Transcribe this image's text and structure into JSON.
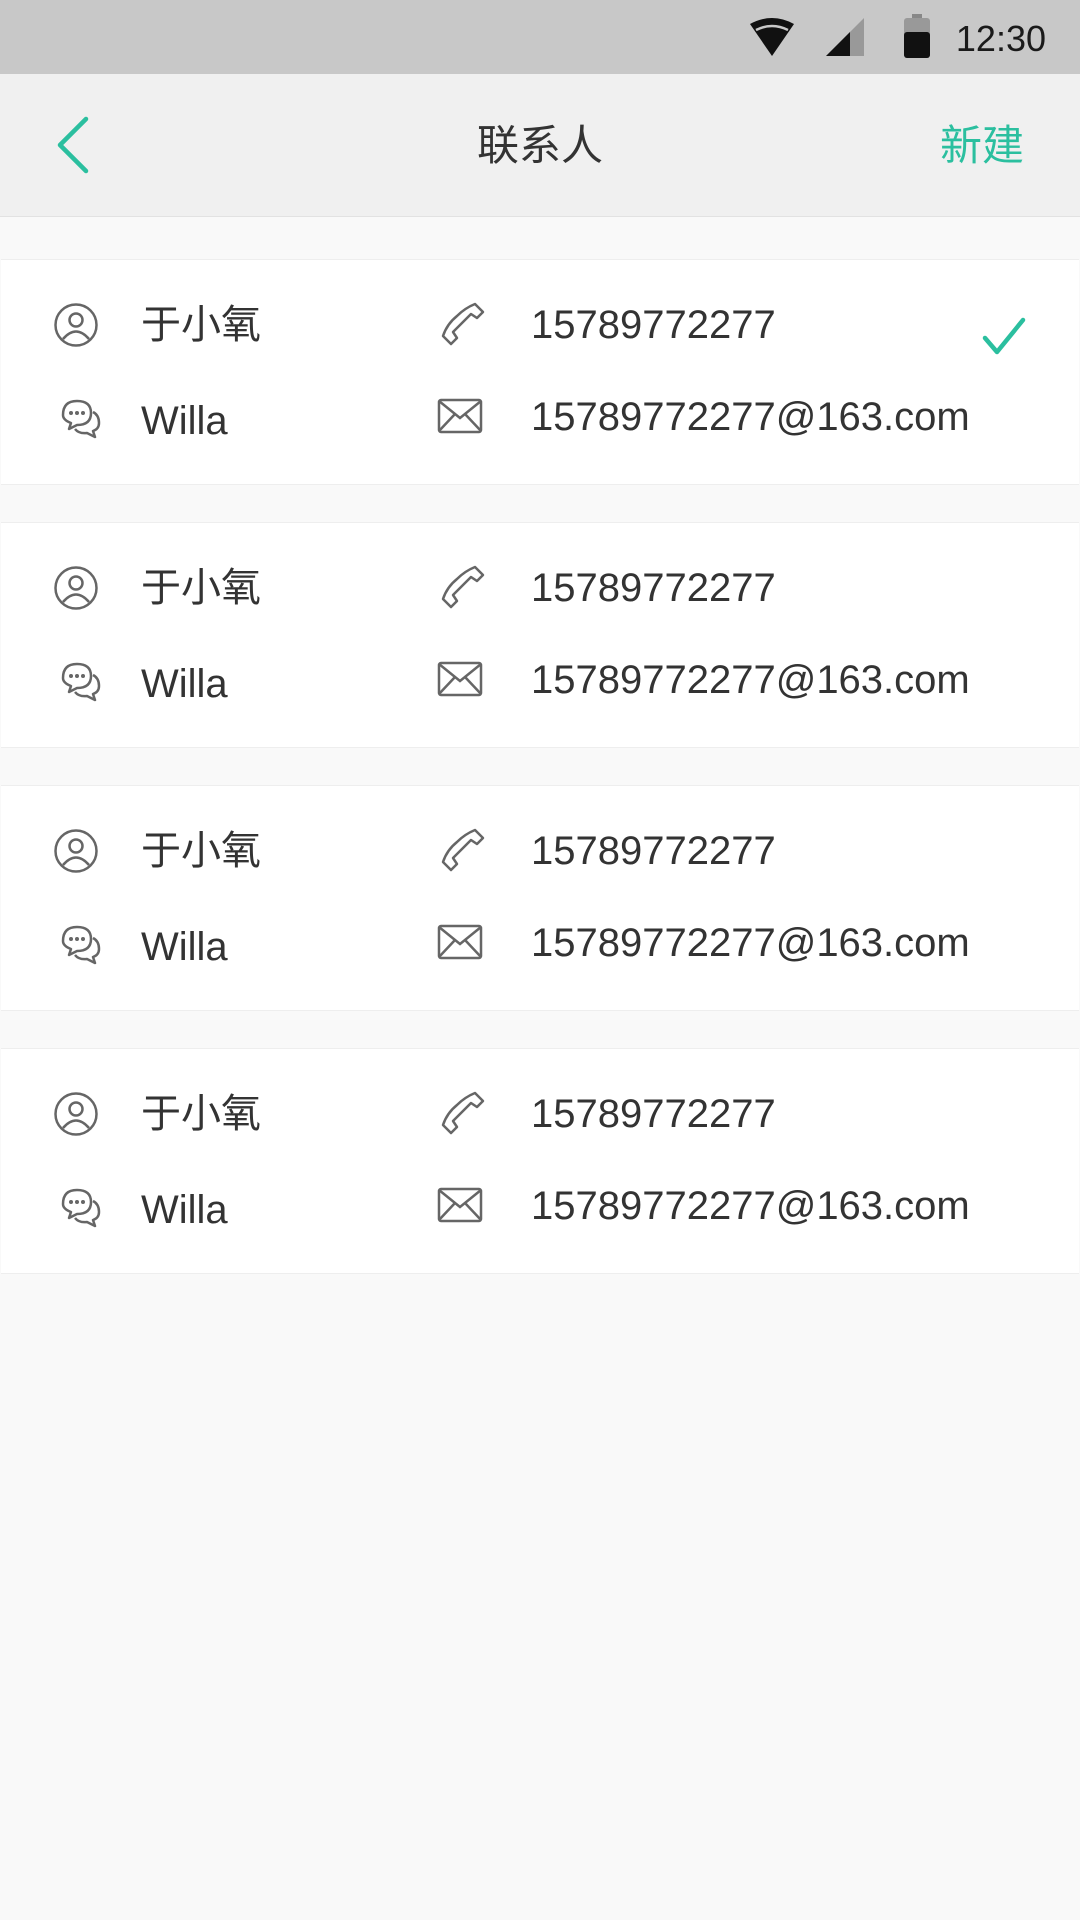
{
  "status_bar": {
    "time": "12:30",
    "icons": [
      "wifi-icon",
      "cellular-signal-icon",
      "battery-icon"
    ]
  },
  "nav": {
    "back_icon": "chevron-left-icon",
    "title": "联系人",
    "new_label": "新建"
  },
  "colors": {
    "accent": "#2bbf9f",
    "status_bar": "#c8c8c8",
    "nav_bar": "#f0f0f0",
    "page_background": "#f9f9f9",
    "card_background": "#ffffff",
    "icon": "#666666",
    "text": "#333333"
  },
  "contacts": [
    {
      "name": "于小氧",
      "alias": "Willa",
      "phone": "15789772277",
      "email": "15789772277@163.com",
      "selected": true
    },
    {
      "name": "于小氧",
      "alias": "Willa",
      "phone": "15789772277",
      "email": "15789772277@163.com",
      "selected": false
    },
    {
      "name": "于小氧",
      "alias": "Willa",
      "phone": "15789772277",
      "email": "15789772277@163.com",
      "selected": false
    },
    {
      "name": "于小氧",
      "alias": "Willa",
      "phone": "15789772277",
      "email": "15789772277@163.com",
      "selected": false
    }
  ]
}
